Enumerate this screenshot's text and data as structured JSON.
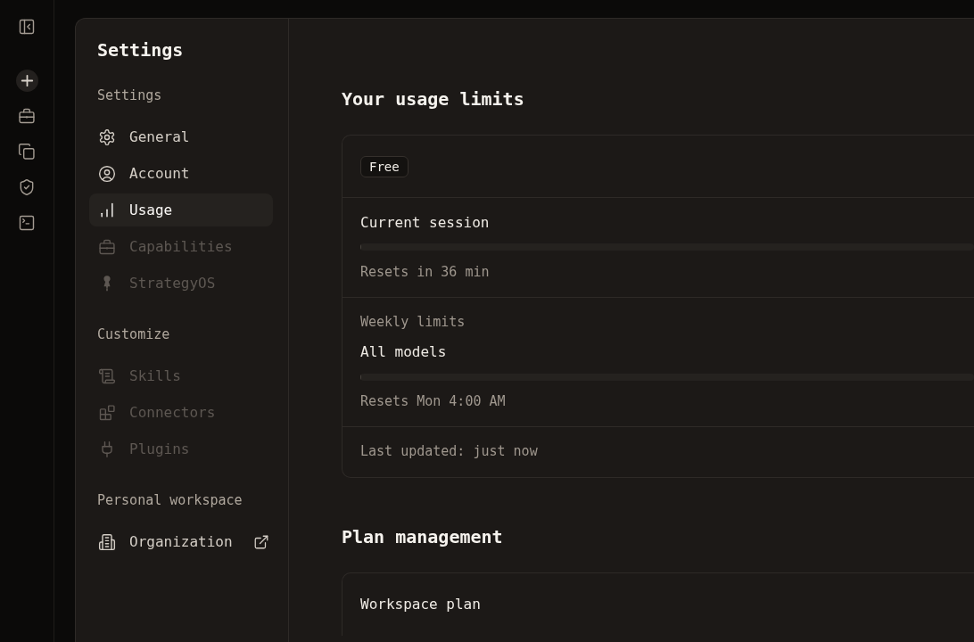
{
  "settings_nav": {
    "title": "Settings",
    "sections": [
      {
        "heading": "Settings",
        "items": [
          {
            "label": "General",
            "selected": false,
            "disabled": false,
            "external": false
          },
          {
            "label": "Account",
            "selected": false,
            "disabled": false,
            "external": false
          },
          {
            "label": "Usage",
            "selected": true,
            "disabled": false,
            "external": false
          },
          {
            "label": "Capabilities",
            "selected": false,
            "disabled": true,
            "external": false
          },
          {
            "label": "StrategyOS",
            "selected": false,
            "disabled": true,
            "external": false
          }
        ]
      },
      {
        "heading": "Customize",
        "items": [
          {
            "label": "Skills",
            "selected": false,
            "disabled": true,
            "external": false
          },
          {
            "label": "Connectors",
            "selected": false,
            "disabled": true,
            "external": false
          },
          {
            "label": "Plugins",
            "selected": false,
            "disabled": true,
            "external": false
          }
        ]
      },
      {
        "heading": "Personal workspace",
        "items": [
          {
            "label": "Organization",
            "selected": false,
            "disabled": false,
            "external": true
          }
        ]
      }
    ]
  },
  "usage_limits": {
    "title": "Your usage limits",
    "plan_badge": "Free",
    "groups": [
      {
        "limits": [
          {
            "label": "Current session",
            "level": 0,
            "reset": "Resets in 36 min"
          }
        ]
      },
      {
        "heading": "Weekly limits",
        "limits": [
          {
            "label": "All models",
            "level": 0,
            "reset": "Resets Mon 4:00 AM"
          }
        ]
      }
    ],
    "last_updated": "Last updated: just now"
  },
  "plan_management": {
    "title": "Plan management",
    "rows": [
      {
        "label": "Workspace plan"
      }
    ]
  }
}
